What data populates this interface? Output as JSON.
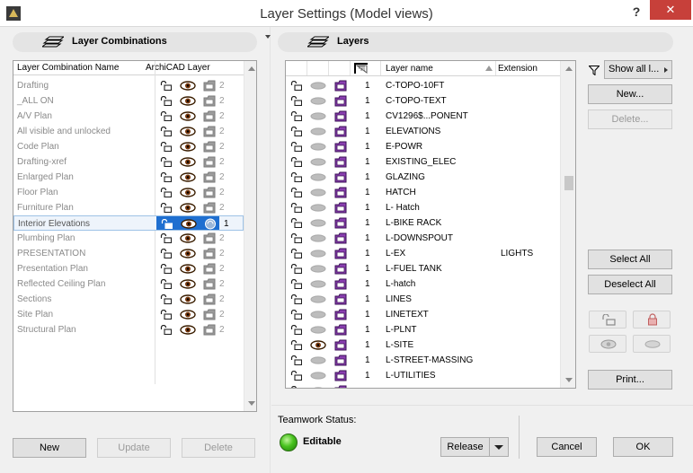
{
  "window": {
    "title": "Layer Settings (Model views)",
    "help_label": "?",
    "close_label": "✕"
  },
  "layer_combinations": {
    "header": "Layer Combinations",
    "columns": {
      "name": "Layer Combination Name",
      "archicad_layer": "ArchiCAD Layer"
    },
    "rows": [
      {
        "name": "Drafting",
        "num": "2"
      },
      {
        "name": "_ALL ON",
        "num": "2"
      },
      {
        "name": "A/V Plan",
        "num": "2"
      },
      {
        "name": "All visible and unlocked",
        "num": "2"
      },
      {
        "name": "Code Plan",
        "num": "2"
      },
      {
        "name": "Drafting-xref",
        "num": "2"
      },
      {
        "name": "Enlarged Plan",
        "num": "2"
      },
      {
        "name": "Floor Plan",
        "num": "2"
      },
      {
        "name": "Furniture Plan",
        "num": "2"
      },
      {
        "name": "Interior Elevations",
        "num": "1",
        "selected": true
      },
      {
        "name": "Plumbing Plan",
        "num": "2"
      },
      {
        "name": "PRESENTATION",
        "num": "2"
      },
      {
        "name": "Presentation Plan",
        "num": "2"
      },
      {
        "name": "Reflected Ceiling Plan",
        "num": "2"
      },
      {
        "name": "Sections",
        "num": "2"
      },
      {
        "name": "Site Plan",
        "num": "2"
      },
      {
        "name": "Structural Plan",
        "num": "2"
      }
    ],
    "buttons": {
      "new": "New",
      "update": "Update",
      "delete": "Delete"
    }
  },
  "layers": {
    "header": "Layers",
    "columns": {
      "name": "Layer name",
      "extension": "Extension"
    },
    "rows": [
      {
        "num": "1",
        "name": "C-TOPO-10FT",
        "ext": ""
      },
      {
        "num": "1",
        "name": "C-TOPO-TEXT",
        "ext": ""
      },
      {
        "num": "1",
        "name": "CV1296$...PONENT",
        "ext": ""
      },
      {
        "num": "1",
        "name": "ELEVATIONS",
        "ext": ""
      },
      {
        "num": "1",
        "name": "E-POWR",
        "ext": ""
      },
      {
        "num": "1",
        "name": "EXISTING_ELEC",
        "ext": ""
      },
      {
        "num": "1",
        "name": "GLAZING",
        "ext": ""
      },
      {
        "num": "1",
        "name": "HATCH",
        "ext": ""
      },
      {
        "num": "1",
        "name": "L- Hatch",
        "ext": ""
      },
      {
        "num": "1",
        "name": "L-BIKE RACK",
        "ext": ""
      },
      {
        "num": "1",
        "name": "L-DOWNSPOUT",
        "ext": ""
      },
      {
        "num": "1",
        "name": "L-EX",
        "ext": "LIGHTS"
      },
      {
        "num": "1",
        "name": "L-FUEL TANK",
        "ext": ""
      },
      {
        "num": "1",
        "name": "L-hatch",
        "ext": ""
      },
      {
        "num": "1",
        "name": "LINES",
        "ext": ""
      },
      {
        "num": "1",
        "name": "LINETEXT",
        "ext": ""
      },
      {
        "num": "1",
        "name": "L-PLNT",
        "ext": ""
      },
      {
        "num": "1",
        "name": "L-SITE",
        "ext": "",
        "visible": true
      },
      {
        "num": "1",
        "name": "L-STREET-MASSING",
        "ext": ""
      },
      {
        "num": "1",
        "name": "L-UTILITIES",
        "ext": ""
      },
      {
        "num": "",
        "name": "",
        "ext": ""
      }
    ]
  },
  "right_panel": {
    "show_all": "Show all l...",
    "new": "New...",
    "delete": "Delete...",
    "select_all": "Select All",
    "deselect_all": "Deselect All",
    "print": "Print..."
  },
  "teamwork": {
    "label": "Teamwork Status:",
    "status": "Editable",
    "release": "Release"
  },
  "dialog": {
    "cancel": "Cancel",
    "ok": "OK"
  },
  "colors": {
    "selection": "#1f6fd0",
    "close": "#c7403a",
    "status_led": "#48c21e",
    "folder_purple": "#8a3fb0"
  }
}
